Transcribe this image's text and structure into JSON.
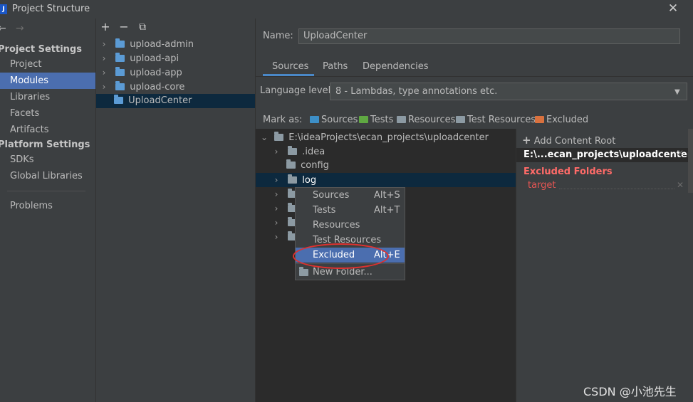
{
  "window": {
    "title": "Project Structure",
    "logo_text": "J",
    "close_glyph": "✕"
  },
  "nav": {
    "back_glyph": "←",
    "forward_glyph": "→"
  },
  "sidebar": {
    "project_settings_header": "Project Settings",
    "project_settings_items": [
      "Project",
      "Modules",
      "Libraries",
      "Facets",
      "Artifacts"
    ],
    "platform_settings_header": "Platform Settings",
    "platform_settings_items": [
      "SDKs",
      "Global Libraries"
    ],
    "problems": "Problems",
    "selected": "Modules"
  },
  "modules_toolbar": {
    "add": "+",
    "remove": "−",
    "copy": "⧉"
  },
  "modules": [
    {
      "name": "upload-admin",
      "expandable": true
    },
    {
      "name": "upload-api",
      "expandable": true
    },
    {
      "name": "upload-app",
      "expandable": true
    },
    {
      "name": "upload-core",
      "expandable": true
    },
    {
      "name": "UploadCenter",
      "expandable": false,
      "selected": true
    }
  ],
  "module_detail": {
    "name_label": "Name:",
    "name_value": "UploadCenter",
    "tabs": [
      "Sources",
      "Paths",
      "Dependencies"
    ],
    "active_tab": "Sources",
    "language_level_label": "Language level:",
    "language_level_value": "8 - Lambdas, type annotations etc.",
    "mark_as_label": "Mark as:",
    "mark_as": [
      {
        "label": "Sources",
        "color": "#3d8fc7"
      },
      {
        "label": "Tests",
        "color": "#5fa842"
      },
      {
        "label": "Resources",
        "color": "#8c9aa3"
      },
      {
        "label": "Test Resources",
        "color": "#8c9aa3"
      },
      {
        "label": "Excluded",
        "color": "#d9713e"
      }
    ]
  },
  "tree": {
    "root": "E:\\ideaProjects\\ecan_projects\\uploadcenter",
    "children": [
      {
        "name": ".idea",
        "expandable": true
      },
      {
        "name": "config",
        "expandable": false
      },
      {
        "name": "log",
        "expandable": true,
        "selected": true
      }
    ]
  },
  "content_roots": {
    "add_label": "Add Content Root",
    "root_path": "E:\\...ecan_projects\\uploadcenter",
    "excluded_title": "Excluded Folders",
    "excluded": [
      "target"
    ],
    "remove_glyph": "✕"
  },
  "context_menu": {
    "items": [
      {
        "label": "Sources",
        "shortcut": "Alt+S"
      },
      {
        "label": "Tests",
        "shortcut": "Alt+T"
      },
      {
        "label": "Resources",
        "shortcut": ""
      },
      {
        "label": "Test Resources",
        "shortcut": ""
      },
      {
        "label": "Excluded",
        "shortcut": "Alt+E",
        "selected": true
      }
    ],
    "new_folder": "New Folder...",
    "highlight_color": "#e0312f"
  },
  "watermark": "CSDN @小池先生",
  "colors": {
    "accent": "#4b6eaf",
    "tree_selection": "#0d293e",
    "excluded_red": "#ff6b68"
  }
}
